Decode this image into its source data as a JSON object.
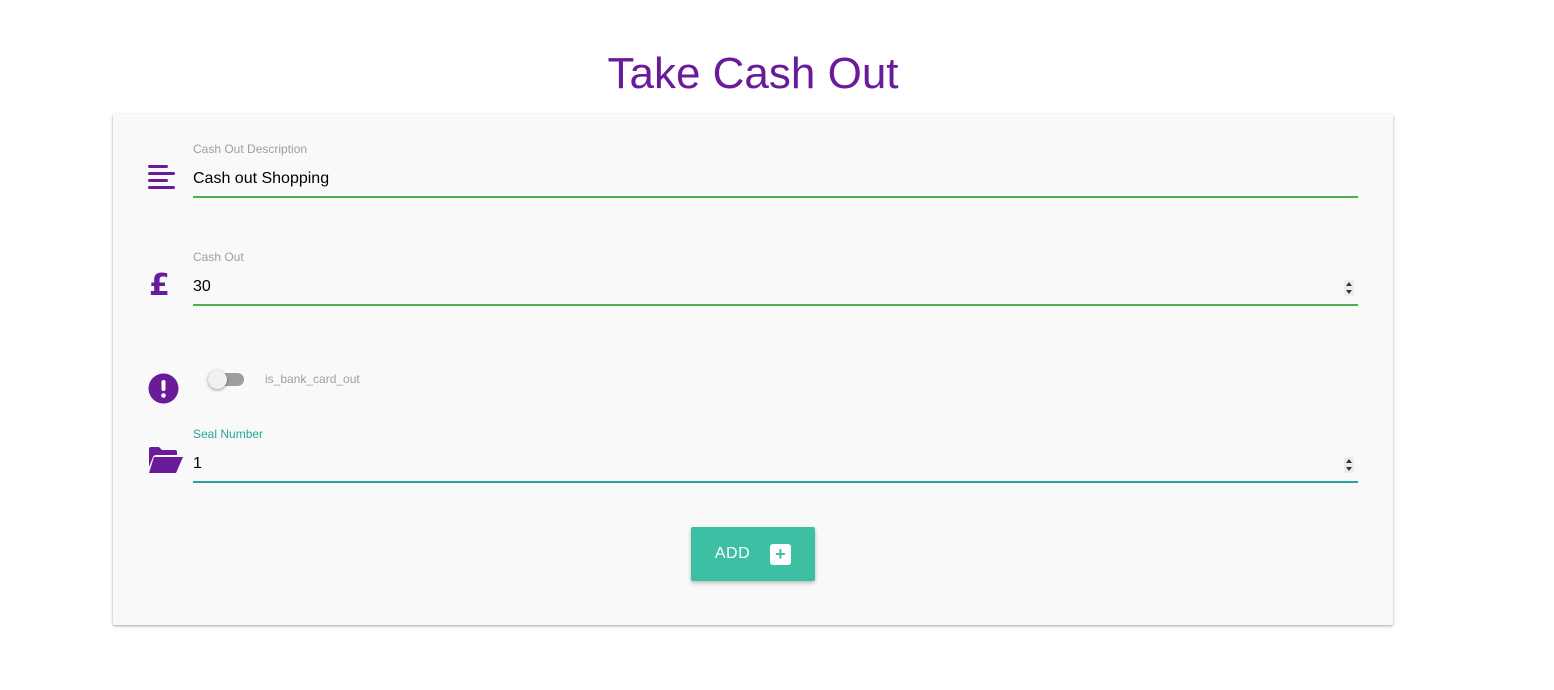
{
  "page": {
    "title": "Take Cash Out"
  },
  "form": {
    "description": {
      "icon": "align-left-icon",
      "label": "Cash Out Description",
      "value": "Cash out Shopping"
    },
    "cash_out": {
      "icon": "pound-sign-icon",
      "label": "Cash Out",
      "value": "30"
    },
    "bank_card_out": {
      "icon": "exclamation-circle-icon",
      "label": "is_bank_card_out",
      "checked": false
    },
    "seal_number": {
      "icon": "folder-open-icon",
      "label": "Seal Number",
      "value": "1"
    },
    "add_button": {
      "label": "ADD",
      "icon": "plus-square-icon",
      "icon_glyph": "+"
    }
  },
  "colors": {
    "accent": "#6a1b9a",
    "button": "#3dbfa4",
    "input_valid": "#4caf50",
    "input_focus": "#26a69a"
  }
}
